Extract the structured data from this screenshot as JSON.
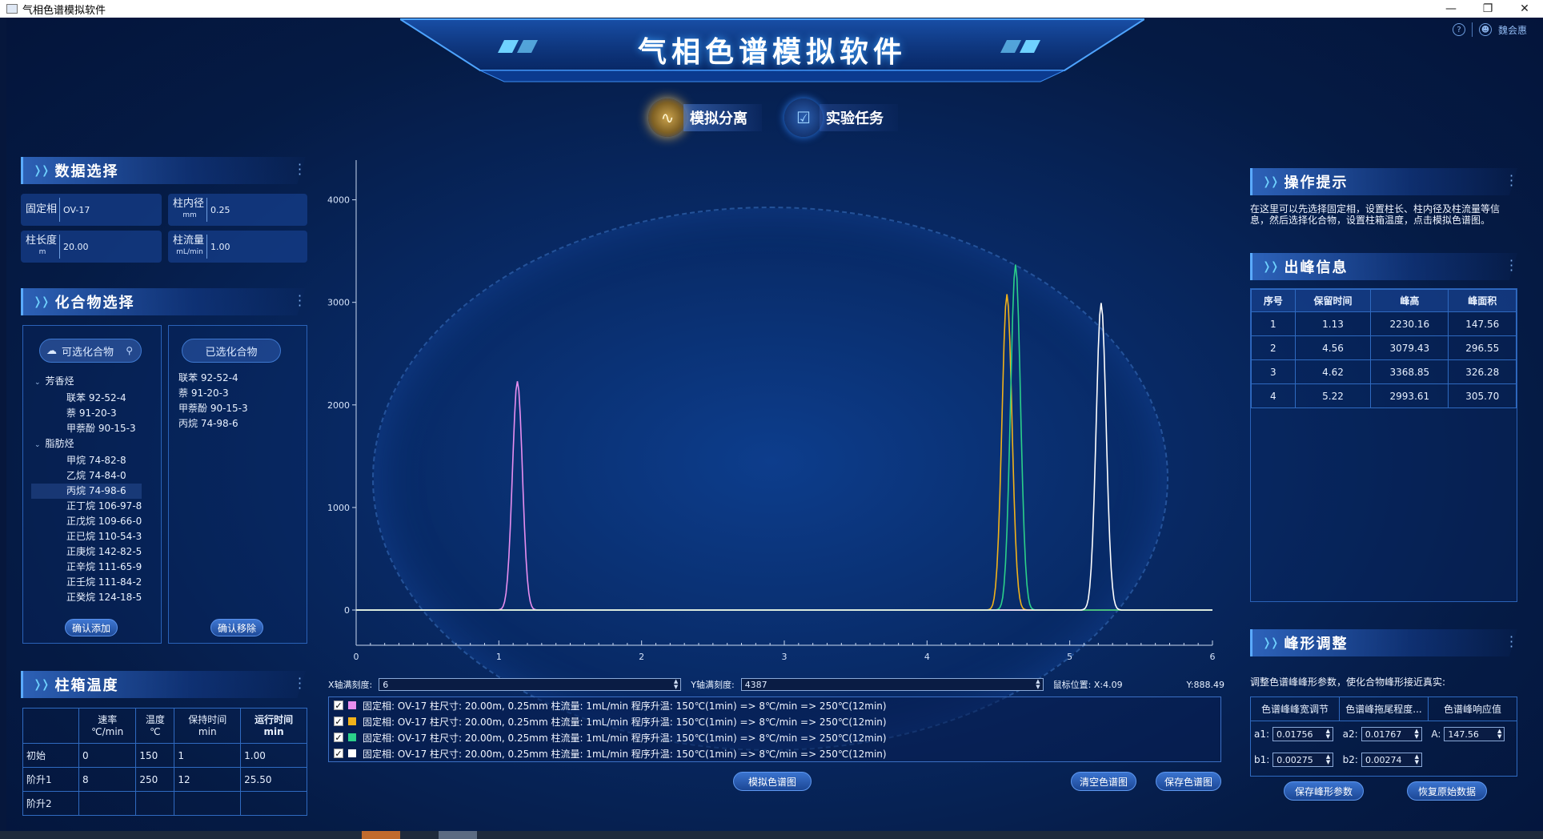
{
  "window": {
    "title": "气相色谱模拟软件",
    "controls": {
      "minimize": "—",
      "restore": "❐",
      "close": "✕"
    }
  },
  "header": {
    "app_title": "气相色谱模拟软件",
    "user_name": "魏会惠",
    "help_icon": "?",
    "user_icon": "user-icon"
  },
  "main_tabs": [
    {
      "label": "模拟分离",
      "icon": "chromatogram-icon",
      "active": true
    },
    {
      "label": "实验任务",
      "icon": "task-check-icon",
      "active": false
    }
  ],
  "data_select": {
    "title": "数据选择",
    "fields": [
      {
        "label": "固定相",
        "unit": "",
        "value": "OV-17"
      },
      {
        "label": "柱内径",
        "unit": "mm",
        "value": "0.25"
      },
      {
        "label": "柱长度",
        "unit": "m",
        "value": "20.00"
      },
      {
        "label": "柱流量",
        "unit": "mL/min",
        "value": "1.00"
      }
    ]
  },
  "compound_select": {
    "title": "化合物选择",
    "search_label": "可选化合物",
    "tree": [
      {
        "group": "芳香烃",
        "items": [
          "联苯 92-52-4",
          "萘 91-20-3",
          "甲萘酚 90-15-3"
        ]
      },
      {
        "group": "脂肪烃",
        "items": [
          "甲烷 74-82-8",
          "乙烷 74-84-0",
          "丙烷 74-98-6",
          "正丁烷 106-97-8",
          "正戊烷 109-66-0",
          "正已烷 110-54-3",
          "正庚烷 142-82-5",
          "正辛烷 111-65-9",
          "正壬烷 111-84-2",
          "正癸烷 124-18-5"
        ]
      }
    ],
    "add_button": "确认添加",
    "selected_label": "已选化合物",
    "selected_items": [
      "联苯 92-52-4",
      "萘 91-20-3",
      "甲萘酚 90-15-3",
      "丙烷 74-98-6"
    ],
    "remove_button": "确认移除"
  },
  "oven": {
    "title": "柱箱温度",
    "headers": [
      {
        "main": "速率",
        "sub": "℃/min",
        "bold": false
      },
      {
        "main": "温度",
        "sub": "℃",
        "bold": false
      },
      {
        "main": "保持时间",
        "sub": "min",
        "bold": false
      },
      {
        "main": "运行时间",
        "sub": "min",
        "bold": true
      }
    ],
    "rows": [
      {
        "label": "初始",
        "cells": [
          "0",
          "150",
          "1",
          "1.00"
        ]
      },
      {
        "label": "阶升1",
        "cells": [
          "8",
          "250",
          "12",
          "25.50"
        ]
      },
      {
        "label": "阶升2",
        "cells": [
          "",
          "",
          "",
          ""
        ]
      }
    ]
  },
  "chart_data": {
    "type": "line",
    "x_ticks": [
      0,
      1,
      2,
      3,
      4,
      5,
      6
    ],
    "y_ticks": [
      0,
      1000,
      2000,
      3000,
      4000
    ],
    "xlim": [
      0,
      6
    ],
    "ylim": [
      0,
      4387
    ],
    "grid": false,
    "series": [
      {
        "color": "#e88ef0",
        "peak": {
          "x": 1.13,
          "height": 2230.16
        }
      },
      {
        "color": "#f2b21a",
        "peak": {
          "x": 4.56,
          "height": 3079.43
        }
      },
      {
        "color": "#2bd08a",
        "peak": {
          "x": 4.62,
          "height": 3368.85
        }
      },
      {
        "color": "#ffffff",
        "peak": {
          "x": 5.22,
          "height": 2993.61
        }
      }
    ]
  },
  "axis_controls": {
    "x_label": "X轴满刻度:",
    "x_value": "6",
    "y_label": "Y轴满刻度:",
    "y_value": "4387",
    "mouse_label": "鼠标位置: X:4.09",
    "mouse_y": "Y:888.49"
  },
  "series_list": [
    {
      "color": "#e88ef0",
      "text": "固定相: OV-17  柱尺寸: 20.00m, 0.25mm  柱流量: 1mL/min 程序升温: 150℃(1min) => 8℃/min => 250℃(12min)"
    },
    {
      "color": "#f2b21a",
      "text": "固定相: OV-17  柱尺寸: 20.00m, 0.25mm  柱流量: 1mL/min 程序升温: 150℃(1min) => 8℃/min => 250℃(12min)"
    },
    {
      "color": "#2bd08a",
      "text": "固定相: OV-17  柱尺寸: 20.00m, 0.25mm  柱流量: 1mL/min 程序升温: 150℃(1min) => 8℃/min => 250℃(12min)"
    },
    {
      "color": "#ffffff",
      "text": "固定相: OV-17  柱尺寸: 20.00m, 0.25mm  柱流量: 1mL/min 程序升温: 150℃(1min) => 8℃/min => 250℃(12min)"
    }
  ],
  "buttons": {
    "simulate": "模拟色谱图",
    "clear": "清空色谱图",
    "save": "保存色谱图"
  },
  "hints": {
    "title": "操作提示",
    "text": "在这里可以先选择固定相，设置柱长、柱内径及柱流量等信息，然后选择化合物，设置柱箱温度，点击模拟色谱图。"
  },
  "peaks": {
    "title": "出峰信息",
    "headers": [
      "序号",
      "保留时间",
      "峰高",
      "峰面积"
    ],
    "rows": [
      [
        "1",
        "1.13",
        "2230.16",
        "147.56"
      ],
      [
        "2",
        "4.56",
        "3079.43",
        "296.55"
      ],
      [
        "3",
        "4.62",
        "3368.85",
        "326.28"
      ],
      [
        "4",
        "5.22",
        "2993.61",
        "305.70"
      ]
    ]
  },
  "peak_adjust": {
    "title": "峰形调整",
    "hint": "调整色谱峰峰形参数，使化合物峰形接近真实:",
    "headers": [
      "色谱峰峰宽调节",
      "色谱峰拖尾程度...",
      "色谱峰响应值"
    ],
    "row1": [
      {
        "label": "a1:",
        "value": "0.01756"
      },
      {
        "label": "a2:",
        "value": "0.01767"
      },
      {
        "label": "A:",
        "value": "147.56"
      }
    ],
    "row2": [
      {
        "label": "b1:",
        "value": "0.00275"
      },
      {
        "label": "b2:",
        "value": "0.00274"
      }
    ],
    "save_button": "保存峰形参数",
    "restore_button": "恢复原始数据"
  }
}
